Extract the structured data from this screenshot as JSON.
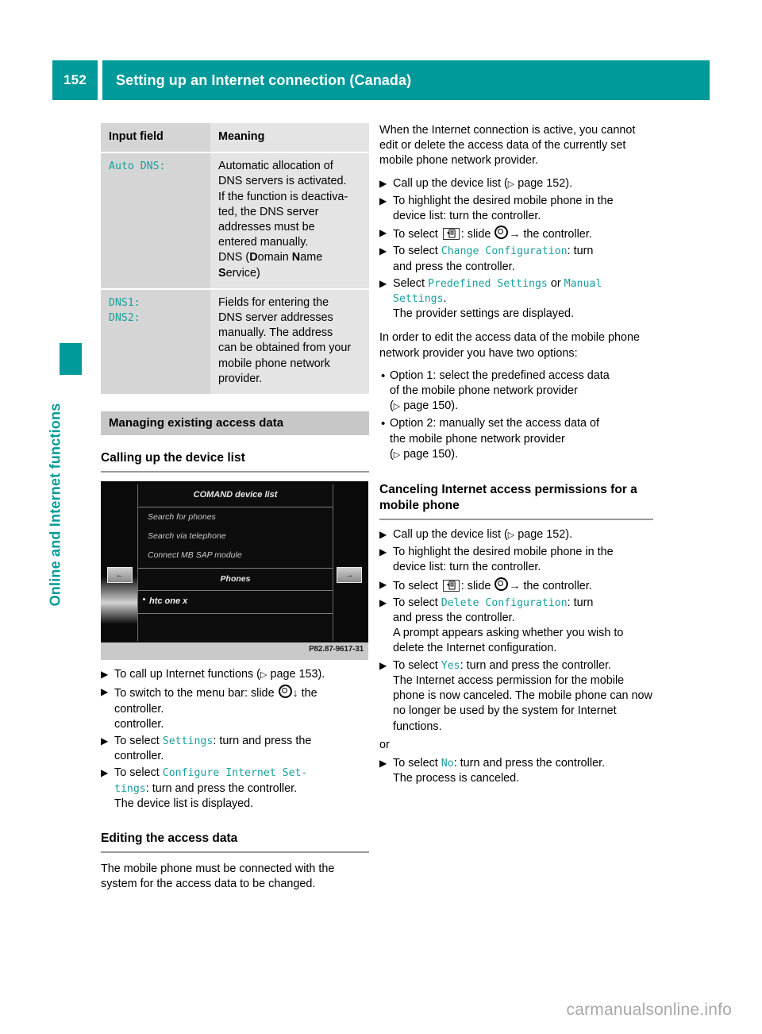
{
  "colors": {
    "accent_teal": "#009a9a",
    "code_teal": "#1a9e9e",
    "banner_gray": "#c7c7c7",
    "table_col1_gray": "#d5d5d5",
    "table_col2_gray": "#e4e4e4"
  },
  "header": {
    "page_number": "152",
    "title": "Setting up an Internet connection (Canada)"
  },
  "sidebar": {
    "chapter_label": "Online and Internet functions"
  },
  "left_column": {
    "table": {
      "headers": [
        "Input field",
        "Meaning"
      ],
      "rows": [
        {
          "field": [
            "Auto DNS:"
          ],
          "meaning_lines": [
            "Automatic allocation of",
            "DNS servers is activated.",
            "If the function is deactiva-",
            "ted, the DNS server",
            "addresses must be",
            "entered manually."
          ],
          "meaning_extra": "DNS (Domain Name Service)"
        },
        {
          "field": [
            "DNS1:",
            "DNS2:"
          ],
          "meaning_lines": [
            "Fields for entering the",
            "DNS server addresses",
            "manually. The address",
            "can be obtained from your",
            "mobile phone network",
            "provider."
          ],
          "meaning_extra": ""
        }
      ]
    },
    "banner": "Managing existing access data",
    "heading_device_list": "Calling up the device list",
    "figure": {
      "title": "COMAND device list",
      "items": [
        "Search for phones",
        "Search via telephone",
        "Connect MB SAP module"
      ],
      "section_label": "Phones",
      "phone_entry": "htc one x",
      "left_button_icon": "back-arrow-icon",
      "right_button_icon": "options-icon",
      "code": "P82.87-9617-31"
    },
    "steps": [
      {
        "pre": "To call up Internet functions (",
        "pageref": "page 153",
        "post": ")."
      },
      {
        "pre": "To switch to the menu bar: slide ",
        "glyph": "controller-ring-down",
        "post": " the controller.",
        "cont": ""
      },
      {
        "pre": "To select ",
        "code": "Settings",
        "post": ": turn and press the",
        "cont": "controller."
      },
      {
        "pre": "To select ",
        "code": "Configure Internet Set-",
        "code2": "tings",
        "post": ": turn and press the controller.",
        "cont": "The device list is displayed."
      }
    ],
    "heading_editing": "Editing the access data",
    "editing_paragraph": "The mobile phone must be connected with the system for the access data to be changed."
  },
  "right_column": {
    "intro_paragraph": "When the Internet connection is active, you cannot edit or delete the access data of the currently set mobile phone network provider.",
    "steps_edit": [
      {
        "pre": "Call up the device list (",
        "pageref": "page 152",
        "post": ")."
      },
      {
        "pre": "To highlight the desired mobile phone in the",
        "cont": "device list: turn the controller."
      },
      {
        "pre": "To select ",
        "glyph": "list-box-icon",
        "mid": ": slide ",
        "glyph2": "controller-ring-right",
        "post": " the controller."
      },
      {
        "pre": "To select ",
        "code": "Change Configuration",
        "post": ": turn",
        "cont": "and press the controller."
      },
      {
        "pre": "Select ",
        "code": "Predefined Settings",
        "mid": " or ",
        "code2": "Manual",
        "code3": "Settings",
        "post": ".",
        "cont": "The provider settings are displayed."
      }
    ],
    "options_paragraph": "In order to edit the access data of the mobile phone network provider you have two options:",
    "options": [
      {
        "line1": "Option 1: select the predefined access data",
        "line2": "of the mobile phone network provider",
        "pageref": "page 150"
      },
      {
        "line1": "Option 2: manually set the access data of",
        "line2": "the mobile phone network provider",
        "pageref": "page 150"
      }
    ],
    "heading_canceling": "Canceling Internet access permissions for a mobile phone",
    "steps_cancel": [
      {
        "pre": "Call up the device list (",
        "pageref": "page 152",
        "post": ")."
      },
      {
        "pre": "To highlight the desired mobile phone in the",
        "cont": "device list: turn the controller."
      },
      {
        "pre": "To select ",
        "glyph": "list-box-icon",
        "mid": ": slide ",
        "glyph2": "controller-ring-right",
        "post": " the controller."
      },
      {
        "pre": "To select ",
        "code": "Delete Configuration",
        "post": ": turn",
        "cont": "and press the controller.",
        "cont2": "A prompt appears asking whether you wish to delete the Internet configuration."
      },
      {
        "pre": "To select ",
        "code": "Yes",
        "post": ": turn and press the controller.",
        "cont": "The Internet access permission for the mobile phone is now canceled. The mobile phone can now no longer be used by the system for Internet functions."
      }
    ],
    "or_label": "or",
    "steps_cancel_alt": [
      {
        "pre": "To select ",
        "code": "No",
        "post": ": turn and press the controller.",
        "cont": "The process is canceled."
      }
    ]
  },
  "watermark": "carmanualsonline.info"
}
